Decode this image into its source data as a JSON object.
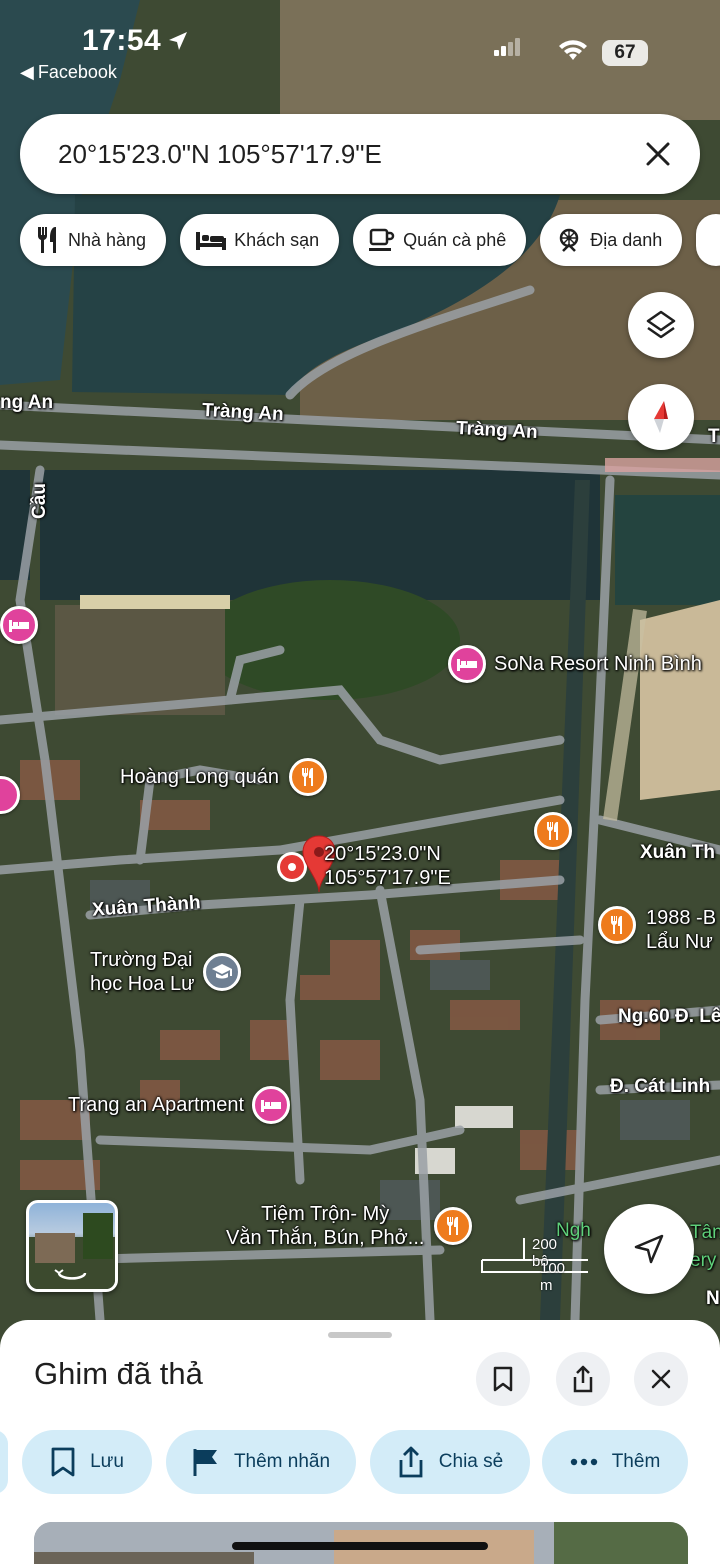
{
  "status_bar": {
    "time": "17:54",
    "back_app": "Facebook",
    "battery": "67"
  },
  "search": {
    "value": "20°15'23.0\"N 105°57'17.9\"E"
  },
  "chips": [
    {
      "label": "Nhà hàng",
      "icon": "restaurant-icon"
    },
    {
      "label": "Khách sạn",
      "icon": "hotel-icon"
    },
    {
      "label": "Quán cà phê",
      "icon": "coffee-icon"
    },
    {
      "label": "Địa danh",
      "icon": "landmark-icon"
    }
  ],
  "map": {
    "road_labels": {
      "trang_an_left": "ng An",
      "trang_an_1": "Tràng An",
      "trang_an_2": "Tràng An",
      "trang_an_right": "T",
      "cau": "Cầu",
      "xuan_thanh": "Xuân Thành",
      "xuan_thanh_right": "Xuân Th",
      "ng60": "Ng.60 Đ. Lê",
      "cat_linh": "Đ. Cát Linh",
      "far_right": "N",
      "right_edge_1": "Tân",
      "right_edge_2": "ery"
    },
    "pois": {
      "sona": "SoNa Resort Ninh Bình",
      "hoang_long": "Hoàng Long quán",
      "truong_1": "Trường Đại",
      "truong_2": "học Hoa Lư",
      "trang_an_apt": "Trang an Apartment",
      "tiem_1": "Tiệm Trộn- Mỳ",
      "tiem_2": "Vằn Thắn, Bún, Phở...",
      "r1988_1": "1988 -B",
      "r1988_2": "Lẩu Nư"
    },
    "dropped_pin": {
      "line1": "20°15'23.0\"N",
      "line2": "105°57'17.9\"E"
    },
    "scale": {
      "top": "200 bộ",
      "bottom": "100 m"
    },
    "green_text": "Ngh"
  },
  "sheet": {
    "title": "Ghim đã thả",
    "actions": [
      {
        "label": "Lưu",
        "icon": "bookmark-icon"
      },
      {
        "label": "Thêm nhãn",
        "icon": "flag-icon"
      },
      {
        "label": "Chia sẻ",
        "icon": "share-icon"
      },
      {
        "label": "Thêm",
        "icon": "more-icon"
      }
    ]
  },
  "colors": {
    "pin_red": "#e53935",
    "poi_pink": "#e0429c",
    "poi_orange": "#ee7b1d",
    "action_bg": "#d3ecf8"
  }
}
